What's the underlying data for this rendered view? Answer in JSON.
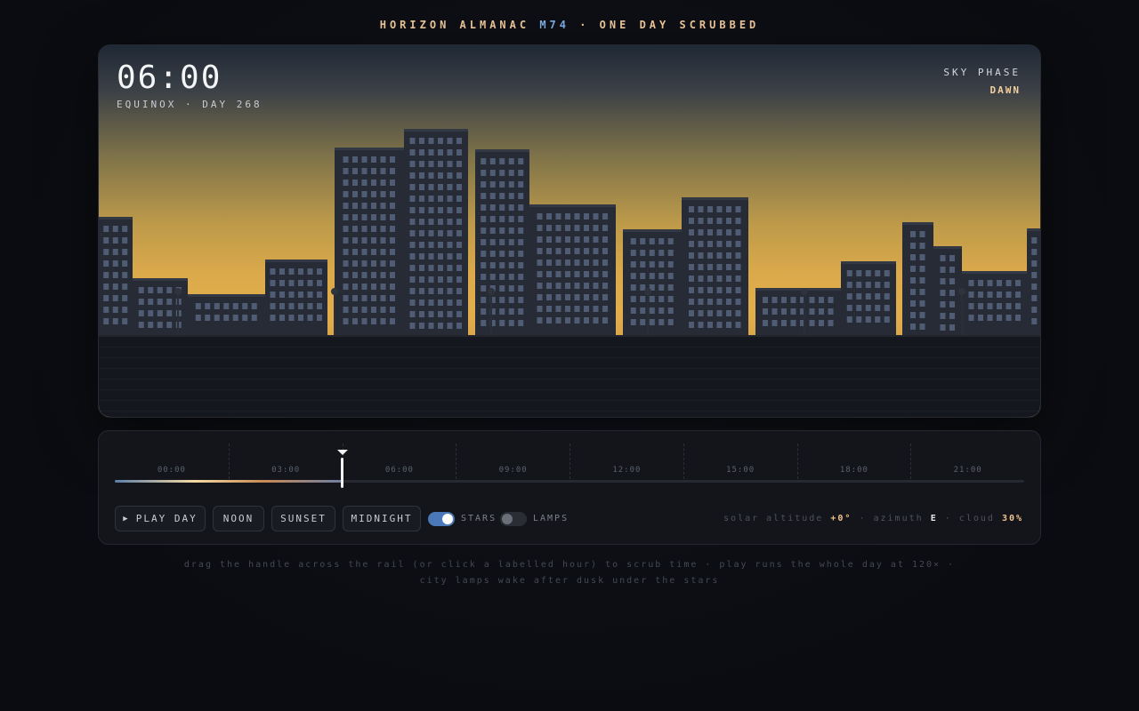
{
  "app": {
    "title_prefix": "HORIZON ALMANAC ",
    "title_model": "M74",
    "title_suffix": " · ONE DAY SCRUBBED"
  },
  "scene": {
    "clock": "06:00",
    "subtitle": "EQUINOX · DAY 268",
    "phase_label": "SKY PHASE",
    "phase_value": "DAWN"
  },
  "timeline": {
    "hours": [
      "00:00",
      "03:00",
      "06:00",
      "09:00",
      "12:00",
      "15:00",
      "18:00",
      "21:00"
    ],
    "position_fraction": 0.25
  },
  "controls": {
    "play_icon": "▶",
    "play_label": "PLAY DAY",
    "noon_label": "NOON",
    "sunset_label": "SUNSET",
    "midnight_label": "MIDNIGHT",
    "stars_label": "STARS",
    "stars_on": true,
    "lamps_label": "LAMPS",
    "lamps_on": false
  },
  "readout": {
    "altitude_label": "solar altitude",
    "altitude_value": "+0°",
    "azimuth_label": "azimuth",
    "azimuth_value": "E",
    "cloud_label": "cloud",
    "cloud_value": "30%"
  },
  "hint": "drag the handle across the rail (or click a labelled hour) to scrub time · play runs the whole day at 120× · city lamps wake after dusk under the stars",
  "colors": {
    "accent": "#f0c89a",
    "model": "#7fb0e6",
    "toggle_on": "#4a78b8",
    "sky_horizon": "#e2ae4c",
    "building": "#262b35",
    "window": "#5d6e88"
  }
}
